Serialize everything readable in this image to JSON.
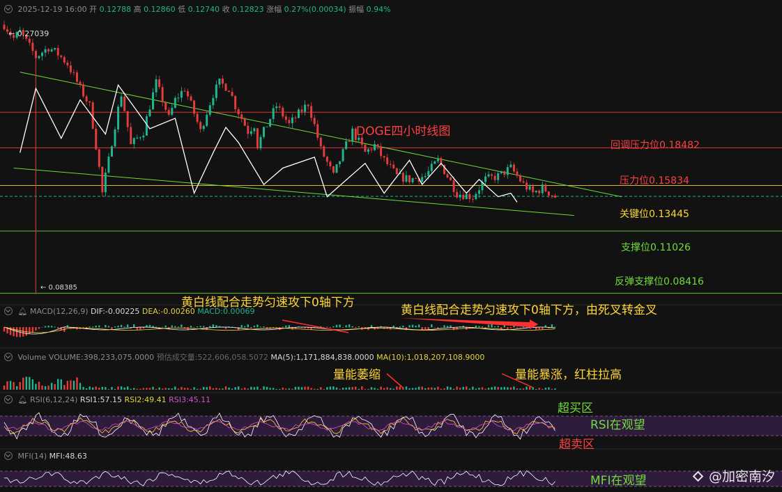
{
  "header": {
    "datetime": "2025-12-19 16:00",
    "open_label": "开",
    "open": "0.12788",
    "high_label": "高",
    "high": "0.12860",
    "low_label": "低",
    "low": "0.12740",
    "close_label": "收",
    "close": "0.12823",
    "change_label": "涨幅",
    "change": "0.27%(0.00034)",
    "amplitude_label": "振幅",
    "amplitude": "0.94%"
  },
  "macd_header": {
    "name": "MACD(12,26,9)",
    "dif": "DIF:-0.00225",
    "dea": "DEA:-0.00260",
    "macd": "MACD:0.00069"
  },
  "volume_header": {
    "name": "Volume",
    "volume": "VOLUME:398,233,075.0000",
    "forecast": "预估成交量:522,606,058.5072",
    "ma5": "MA(5):1,171,884,838.0000",
    "ma10": "MA(10):1,018,207,108.9000"
  },
  "rsi_header": {
    "name": "RSI(6,12,24)",
    "rsi1": "RSI1:57.15",
    "rsi2": "RSI2:49.41",
    "rsi3": "RSI3:45.11"
  },
  "mfi_header": {
    "name": "MFI(14)",
    "mfi": "MFI:48.63"
  },
  "extremes": {
    "high": "← 0.27039",
    "low": "← 0.08385"
  },
  "levels": [
    {
      "label": "回调压力位0.18482",
      "value": 0.18482,
      "color": "#ff3b3b"
    },
    {
      "label": "压力位0.15834",
      "value": 0.15834,
      "color": "#ff3b3b"
    },
    {
      "label": "关键位0.13445",
      "value": 0.13445,
      "color": "#ffd633"
    },
    {
      "label": "支撑位0.11026",
      "value": 0.11026,
      "color": "#6fdc3a"
    },
    {
      "label": "反弹支撑位0.08416",
      "value": 0.08416,
      "color": "#6fdc3a"
    }
  ],
  "annotations": {
    "title": "DOGE四小时线图",
    "macd_note_1": "黄白线配合走势匀速攻下0轴下方",
    "macd_note_2": "黄白线配合走势匀速攻下0轴下方，由死叉转金叉",
    "volume_note_1": "量能萎缩",
    "volume_note_2": "量能暴涨，红柱拉高",
    "rsi_overbought": "超买区",
    "rsi_watch": "RSI在观望",
    "rsi_oversold": "超卖区",
    "mfi_watch": "MFI在观望"
  },
  "watermark": "@加密南汐",
  "colors": {
    "up": "#1fb58f",
    "down": "#e23c3c",
    "background": "#121212",
    "trend": "#6fdc3a",
    "zigzag": "#ffffff",
    "band": "#3a1f4a"
  },
  "chart_data": {
    "type": "line",
    "title": "DOGE四小时线图",
    "y_scale": "log",
    "ylim": [
      0.0815,
      0.285
    ],
    "series": [
      {
        "x": [
          0,
          3,
          5,
          10,
          14,
          17,
          20,
          24,
          27,
          31,
          33,
          37,
          40,
          44,
          48,
          52,
          54,
          57,
          62,
          64,
          66,
          68,
          71,
          73,
          75,
          77,
          79
        ],
        "values": [
          0.27039,
          0.255,
          0.262,
          0.235,
          0.245,
          0.238,
          0.228,
          0.205,
          0.19,
          0.13,
          0.15,
          0.2,
          0.16,
          0.17,
          0.21,
          0.18,
          0.195,
          0.205,
          0.17,
          0.185,
          0.2,
          0.21,
          0.205,
          0.19,
          0.18,
          0.17,
          0.175
        ]
      },
      {
        "x": [
          79,
          80,
          86,
          90,
          96,
          100,
          104,
          110,
          114,
          117,
          120,
          124,
          128,
          133,
          137,
          143,
          148,
          152,
          156,
          160,
          164,
          167,
          170,
          174
        ],
        "values": [
          0.175,
          0.16,
          0.19,
          0.175,
          0.192,
          0.157,
          0.14,
          0.17,
          0.155,
          0.16,
          0.15,
          0.14,
          0.138,
          0.14,
          0.15,
          0.13,
          0.128,
          0.138,
          0.14,
          0.145,
          0.135,
          0.13,
          0.133,
          0.128
        ]
      }
    ],
    "zigzag": {
      "x": [
        5,
        10,
        18,
        24,
        32,
        36,
        46,
        54,
        60,
        66,
        70,
        74,
        82,
        88,
        98,
        102,
        114,
        120,
        128,
        132,
        138,
        146,
        150,
        156,
        160,
        162
      ],
      "values": [
        0.155,
        0.205,
        0.165,
        0.195,
        0.168,
        0.208,
        0.172,
        0.18,
        0.13,
        0.155,
        0.173,
        0.162,
        0.135,
        0.145,
        0.152,
        0.128,
        0.148,
        0.13,
        0.15,
        0.135,
        0.148,
        0.13,
        0.138,
        0.128,
        0.13,
        0.125
      ]
    },
    "trendlines": [
      {
        "x": [
          5,
          195
        ],
        "values": [
          0.22,
          0.128
        ]
      },
      {
        "x": [
          3,
          180
        ],
        "values": [
          0.145,
          0.118
        ]
      }
    ],
    "current_price": 0.12823
  }
}
